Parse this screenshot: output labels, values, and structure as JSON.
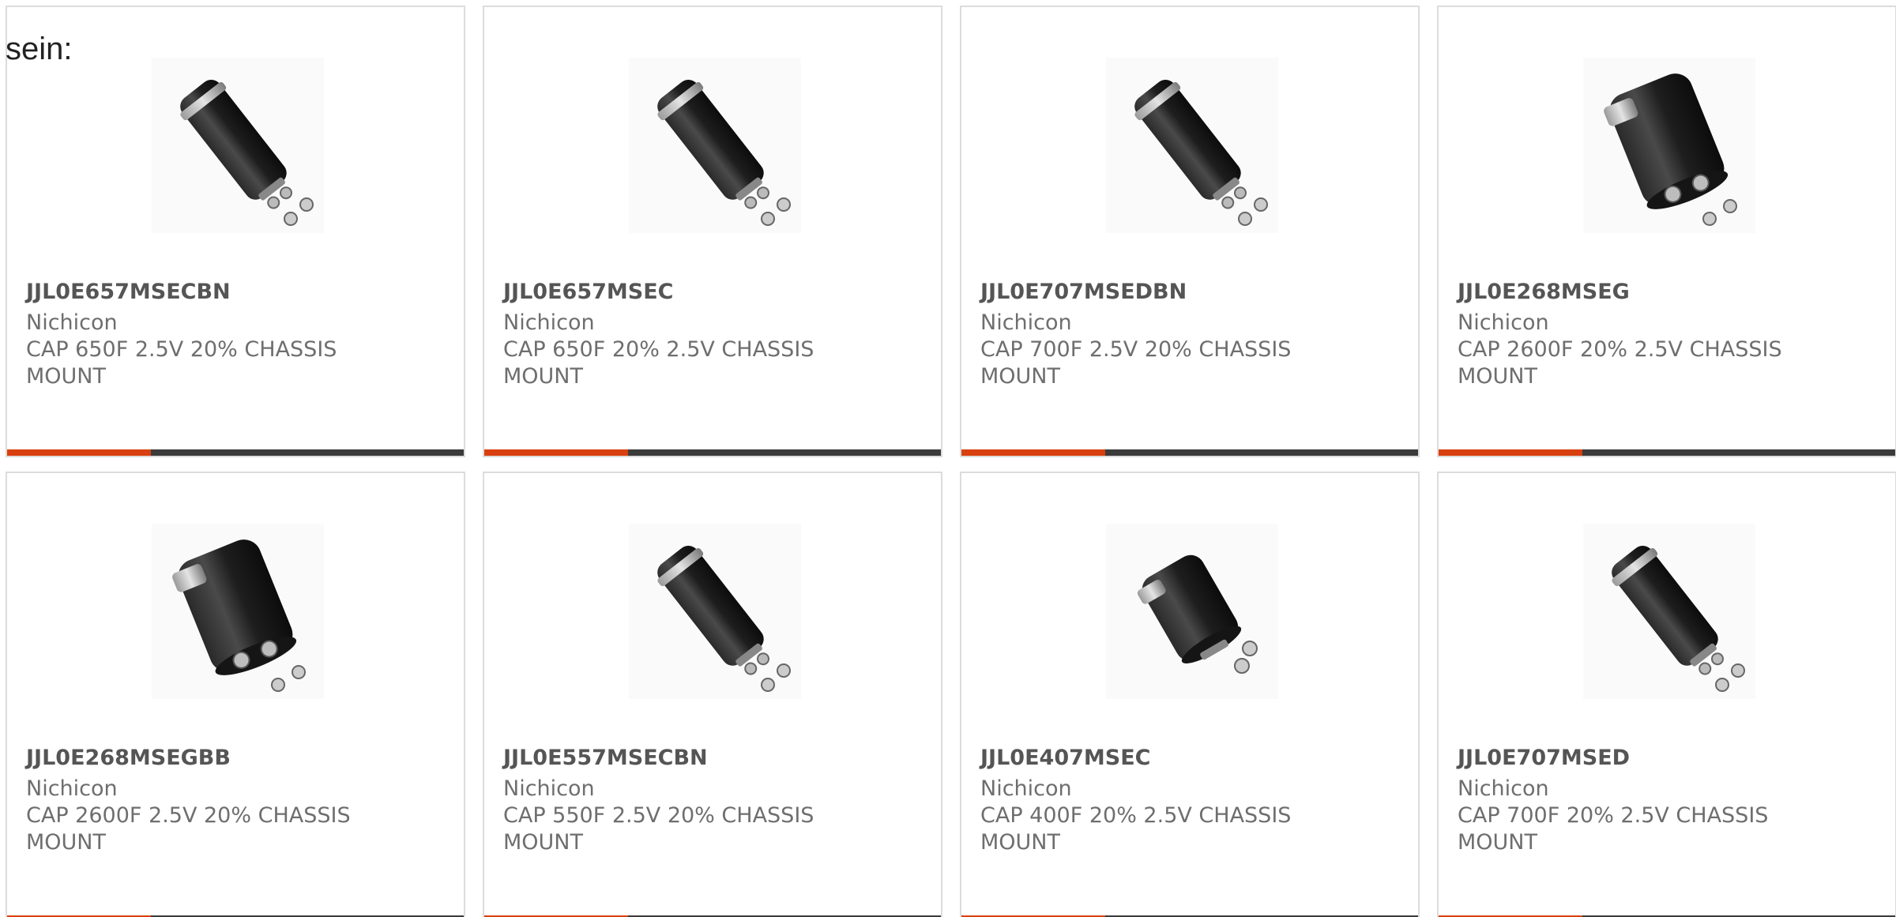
{
  "intro_text": "sein:",
  "colors": {
    "accent": "#d9400f",
    "bar": "#3b3b3b",
    "border": "#dcdcdc",
    "part_number": "#555555",
    "text": "#6e6e6e"
  },
  "products": [
    {
      "part_number": "JJL0E657MSECBN",
      "manufacturer": "Nichicon",
      "description": "CAP 650F 2.5V 20% CHASSIS MOUNT",
      "image": "capacitor-angled-icon"
    },
    {
      "part_number": "JJL0E657MSEC",
      "manufacturer": "Nichicon",
      "description": "CAP 650F 20% 2.5V CHASSIS MOUNT",
      "image": "capacitor-angled-icon"
    },
    {
      "part_number": "JJL0E707MSEDBN",
      "manufacturer": "Nichicon",
      "description": "CAP 700F 2.5V 20% CHASSIS MOUNT",
      "image": "capacitor-angled-icon"
    },
    {
      "part_number": "JJL0E268MSEG",
      "manufacturer": "Nichicon",
      "description": "CAP 2600F 20% 2.5V CHASSIS MOUNT",
      "image": "capacitor-large-icon"
    },
    {
      "part_number": "JJL0E268MSEGBB",
      "manufacturer": "Nichicon",
      "description": "CAP 2600F 2.5V 20% CHASSIS MOUNT",
      "image": "capacitor-large-icon"
    },
    {
      "part_number": "JJL0E557MSECBN",
      "manufacturer": "Nichicon",
      "description": "CAP 550F 2.5V 20% CHASSIS MOUNT",
      "image": "capacitor-angled-icon"
    },
    {
      "part_number": "JJL0E407MSEC",
      "manufacturer": "Nichicon",
      "description": "CAP 400F 20% 2.5V CHASSIS MOUNT",
      "image": "capacitor-short-icon"
    },
    {
      "part_number": "JJL0E707MSED",
      "manufacturer": "Nichicon",
      "description": "CAP 700F 20% 2.5V CHASSIS MOUNT",
      "image": "capacitor-angled-icon"
    }
  ]
}
